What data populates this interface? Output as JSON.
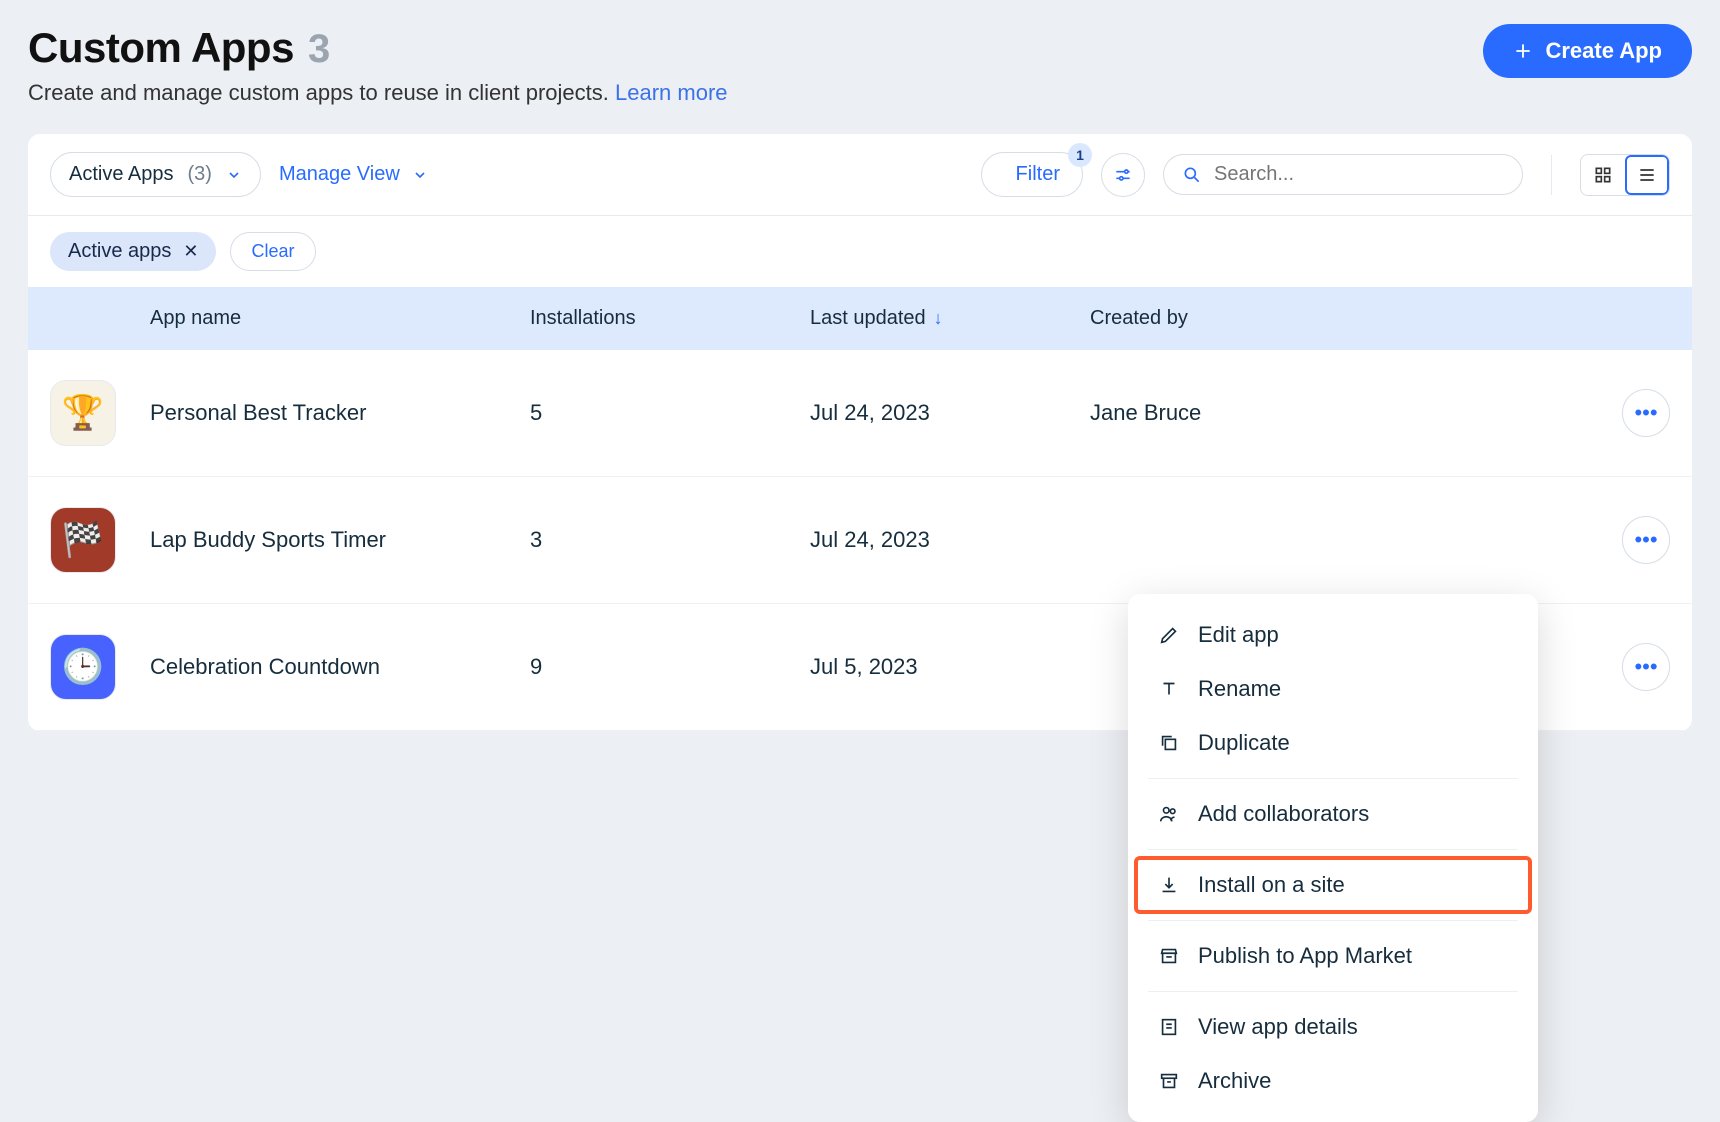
{
  "header": {
    "title": "Custom Apps",
    "count": "3",
    "subtitle": "Create and manage custom apps to reuse in client projects.",
    "learn_more": "Learn more",
    "create_button": "Create App"
  },
  "toolbar": {
    "view_select_label": "Active Apps",
    "view_select_count": "(3)",
    "manage_view": "Manage View",
    "filter_label": "Filter",
    "filter_badge": "1",
    "search_placeholder": "Search..."
  },
  "filters": {
    "chip_label": "Active apps",
    "clear": "Clear"
  },
  "columns": {
    "name": "App name",
    "installs": "Installations",
    "updated": "Last updated",
    "creator": "Created by"
  },
  "rows": [
    {
      "icon_bg": "#f7f2e6",
      "icon": "🏆",
      "name": "Personal Best Tracker",
      "installs": "5",
      "updated": "Jul 24, 2023",
      "creator": "Jane Bruce"
    },
    {
      "icon_bg": "#a23a2a",
      "icon": "🏁",
      "name": "Lap Buddy Sports Timer",
      "installs": "3",
      "updated": "Jul 24, 2023",
      "creator": ""
    },
    {
      "icon_bg": "#4762ff",
      "icon": "🕒",
      "name": "Celebration Countdown",
      "installs": "9",
      "updated": "Jul 5, 2023",
      "creator": ""
    }
  ],
  "menu": {
    "edit": "Edit app",
    "rename": "Rename",
    "duplicate": "Duplicate",
    "collaborators": "Add collaborators",
    "install": "Install on a site",
    "publish": "Publish to App Market",
    "details": "View app details",
    "archive": "Archive"
  }
}
